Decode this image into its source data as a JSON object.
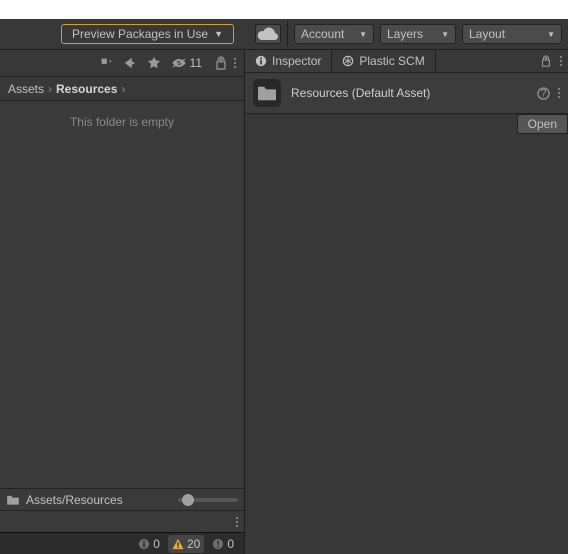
{
  "toolbar": {
    "preview_label": "Preview Packages in Use",
    "account_label": "Account",
    "layers_label": "Layers",
    "layout_label": "Layout"
  },
  "tabs": {
    "inspector": "Inspector",
    "plastic": "Plastic SCM"
  },
  "inspector": {
    "title": "Resources (Default Asset)",
    "open_label": "Open"
  },
  "project": {
    "hidden_count": "11",
    "breadcrumb": {
      "root": "Assets",
      "current": "Resources"
    },
    "empty_text": "This folder is empty",
    "footer_path": "Assets/Resources"
  },
  "console": {
    "info_count": "0",
    "warn_count": "20",
    "error_count": "0"
  }
}
